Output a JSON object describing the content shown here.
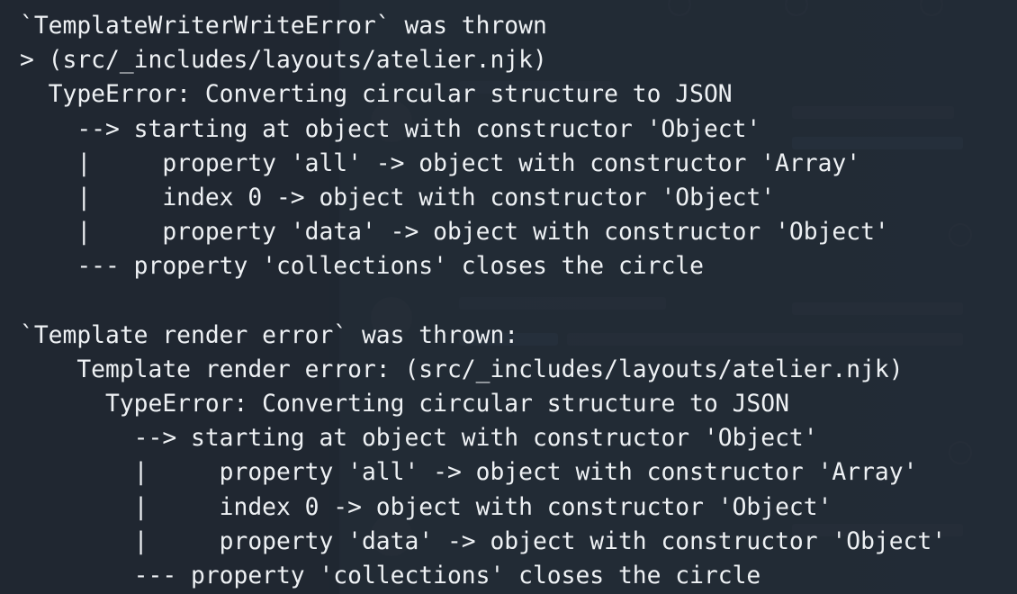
{
  "log": {
    "lines": [
      "`TemplateWriterWriteError` was thrown",
      "> (src/_includes/layouts/atelier.njk)",
      "  TypeError: Converting circular structure to JSON",
      "    --> starting at object with constructor 'Object'",
      "    |     property 'all' -> object with constructor 'Array'",
      "    |     index 0 -> object with constructor 'Object'",
      "    |     property 'data' -> object with constructor 'Object'",
      "    --- property 'collections' closes the circle",
      "",
      "`Template render error` was thrown:",
      "    Template render error: (src/_includes/layouts/atelier.njk)",
      "      TypeError: Converting circular structure to JSON",
      "        --> starting at object with constructor 'Object'",
      "        |     property 'all' -> object with constructor 'Array'",
      "        |     index 0 -> object with constructor 'Object'",
      "        |     property 'data' -> object with constructor 'Object'",
      "        --- property 'collections' closes the circle"
    ]
  },
  "colors": {
    "text": "#eef1f4",
    "overlay": "#1e262f",
    "background": "#2c3540"
  }
}
